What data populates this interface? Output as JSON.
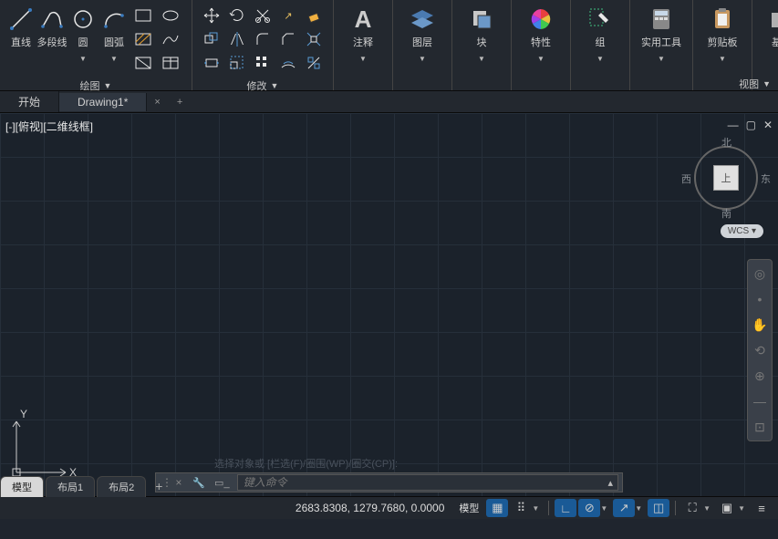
{
  "ribbon": {
    "draw_panel": {
      "title": "绘图",
      "buttons": [
        "直线",
        "多段线",
        "圆",
        "圆弧"
      ]
    },
    "modify_panel": {
      "title": "修改"
    },
    "other_panels": [
      {
        "label": "注释"
      },
      {
        "label": "图层"
      },
      {
        "label": "块"
      },
      {
        "label": "特性"
      },
      {
        "label": "组"
      },
      {
        "label": "实用工具"
      },
      {
        "label": "剪贴板"
      },
      {
        "label": "基点"
      }
    ],
    "view_panel_title": "视图"
  },
  "tabs": {
    "start": "开始",
    "drawing": "Drawing1*"
  },
  "viewport": {
    "label": "[-][俯视][二维线框]",
    "wcs": "WCS",
    "compass": {
      "n": "北",
      "s": "南",
      "e": "东",
      "w": "西",
      "top": "上"
    },
    "axes": {
      "x": "X",
      "y": "Y"
    }
  },
  "command": {
    "placeholder": "键入命令",
    "history": "选择对象或 [栏选(F)/圈围(WP)/圈交(CP)]:"
  },
  "layout_tabs": {
    "model": "模型",
    "layout1": "布局1",
    "layout2": "布局2"
  },
  "status": {
    "coords": "2683.8308, 1279.7680, 0.0000",
    "model": "模型"
  }
}
